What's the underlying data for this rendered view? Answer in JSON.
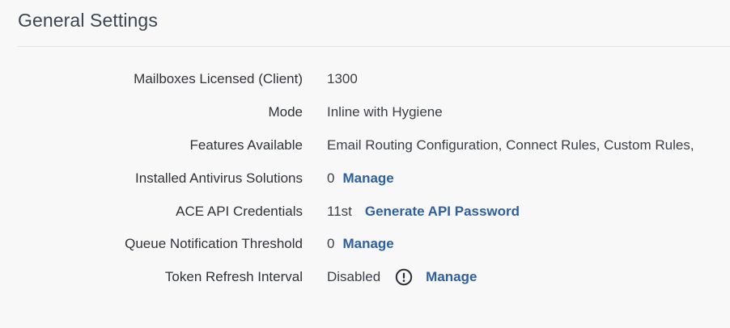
{
  "section": {
    "title": "General Settings"
  },
  "settings": [
    {
      "label": "Mailboxes Licensed (Client)",
      "value": "1300"
    },
    {
      "label": "Mode",
      "value": "Inline with Hygiene"
    },
    {
      "label": "Features Available",
      "value": "Email Routing Configuration, Connect Rules, Custom Rules,"
    },
    {
      "label": "Installed Antivirus Solutions",
      "value": "0",
      "action": "Manage"
    },
    {
      "label": "ACE API Credentials",
      "value": "11st",
      "action": "Generate API Password"
    },
    {
      "label": "Queue Notification Threshold",
      "value": "0",
      "action": "Manage"
    },
    {
      "label": "Token Refresh Interval",
      "value": "Disabled",
      "icon": "exclamation-circle-icon",
      "action": "Manage"
    }
  ],
  "colors": {
    "link": "#2e5f9e",
    "background": "#f8f8f9"
  }
}
